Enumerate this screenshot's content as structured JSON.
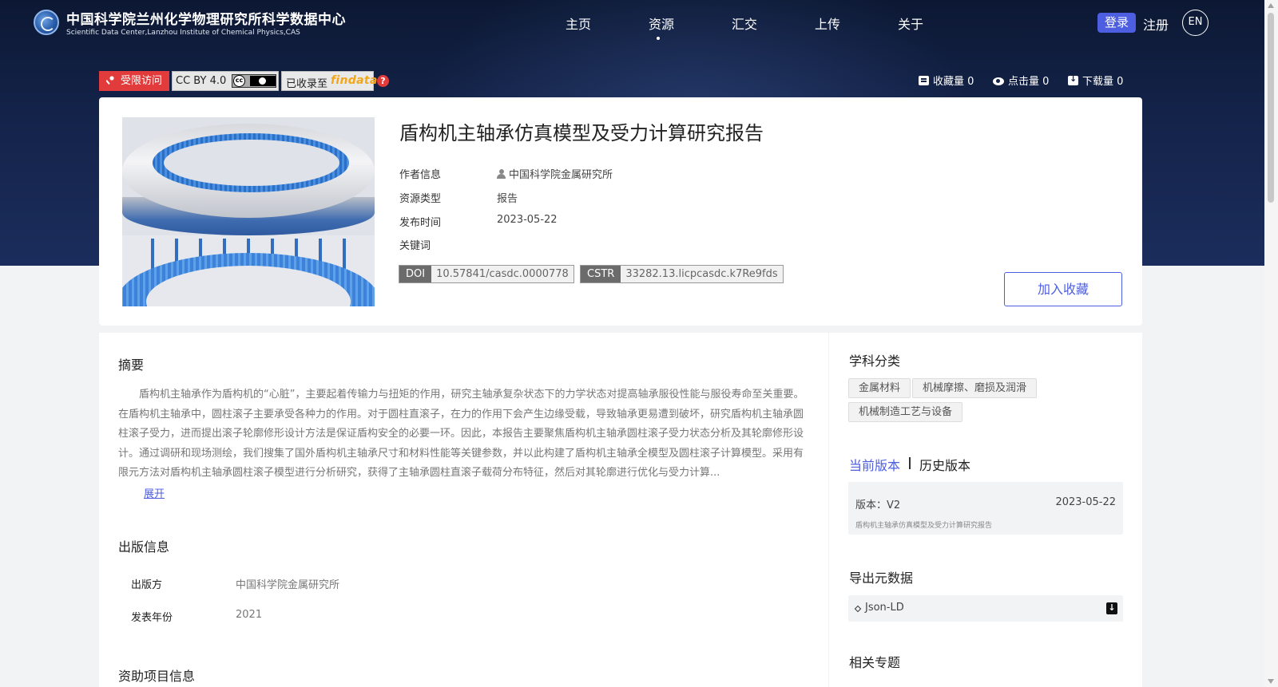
{
  "site": {
    "title": "中国科学院兰州化学物理研究所科学数据中心",
    "subtitle": "Scientific Data Center,Lanzhou Institute of Chemical Physics,CAS"
  },
  "nav": {
    "items": [
      "主页",
      "资源",
      "汇交",
      "上传",
      "关于"
    ],
    "active": "资源",
    "login": "登录",
    "register": "注册",
    "lang": "EN"
  },
  "badges": {
    "access": "受限访问",
    "license": "CC BY 4.0",
    "indexed_prefix": "已收录至",
    "indexed_brand": "findata",
    "help": "?"
  },
  "stats": {
    "favorites": "收藏量 0",
    "clicks": "点击量 0",
    "downloads": "下载量 0"
  },
  "resource": {
    "title": "盾构机主轴承仿真模型及受力计算研究报告",
    "author_label": "作者信息",
    "author": "中国科学院金属研究所",
    "type_label": "资源类型",
    "type": "报告",
    "date_label": "发布时间",
    "date": "2023-05-22",
    "keywords_label": "关键词",
    "doi_label": "DOI",
    "doi": "10.57841/casdc.0000778",
    "cstr_label": "CSTR",
    "cstr": "33282.13.licpcasdc.k7Re9fds",
    "favorite_button": "加入收藏"
  },
  "abstract": {
    "title": "摘要",
    "text": "盾构机主轴承作为盾构机的“心脏”，主要起着传输力与扭矩的作用，研究主轴承复杂状态下的力学状态对提高轴承服役性能与服役寿命至关重要。在盾构机主轴承中，圆柱滚子主要承受各种力的作用。对于圆柱直滚子，在力的作用下会产生边缘受载，导致轴承更易遭到破坏，研究盾构机主轴承圆柱滚子受力，进而提出滚子轮廓修形设计方法是保证盾构安全的必要一环。因此，本报告主要聚焦盾构机主轴承圆柱滚子受力状态分析及其轮廓修形设计。通过调研和现场测绘，我们搜集了国外盾构机主轴承尺寸和材料性能等关键参数，并以此构建了盾构机主轴承全模型及圆柱滚子计算模型。采用有限元方法对盾构机主轴承圆柱滚子模型进行分析研究，获得了主轴承圆柱直滚子载荷分布特征，然后对其轮廓进行优化与受力计算...",
    "expand": "展开"
  },
  "publication": {
    "title": "出版信息",
    "publisher_label": "出版方",
    "publisher": "中国科学院金属研究所",
    "year_label": "发表年份",
    "year": "2021"
  },
  "funding": {
    "title": "资助项目信息"
  },
  "sidebar": {
    "subject_title": "学科分类",
    "subjects": [
      "金属材料",
      "机械摩擦、磨损及润滑",
      "机械制造工艺与设备"
    ],
    "version_tab_current": "当前版本",
    "version_tab_history": "历史版本",
    "version_label": "版本：V2",
    "version_date": "2023-05-22",
    "version_title": "盾构机主轴承仿真模型及受力计算研究报告",
    "export_title": "导出元数据",
    "export_format": "Json-LD",
    "related_title": "相关专题"
  },
  "colors": {
    "accent": "#4d5ee0",
    "restricted": "#e23b3b",
    "header_bg": "#14234a"
  }
}
